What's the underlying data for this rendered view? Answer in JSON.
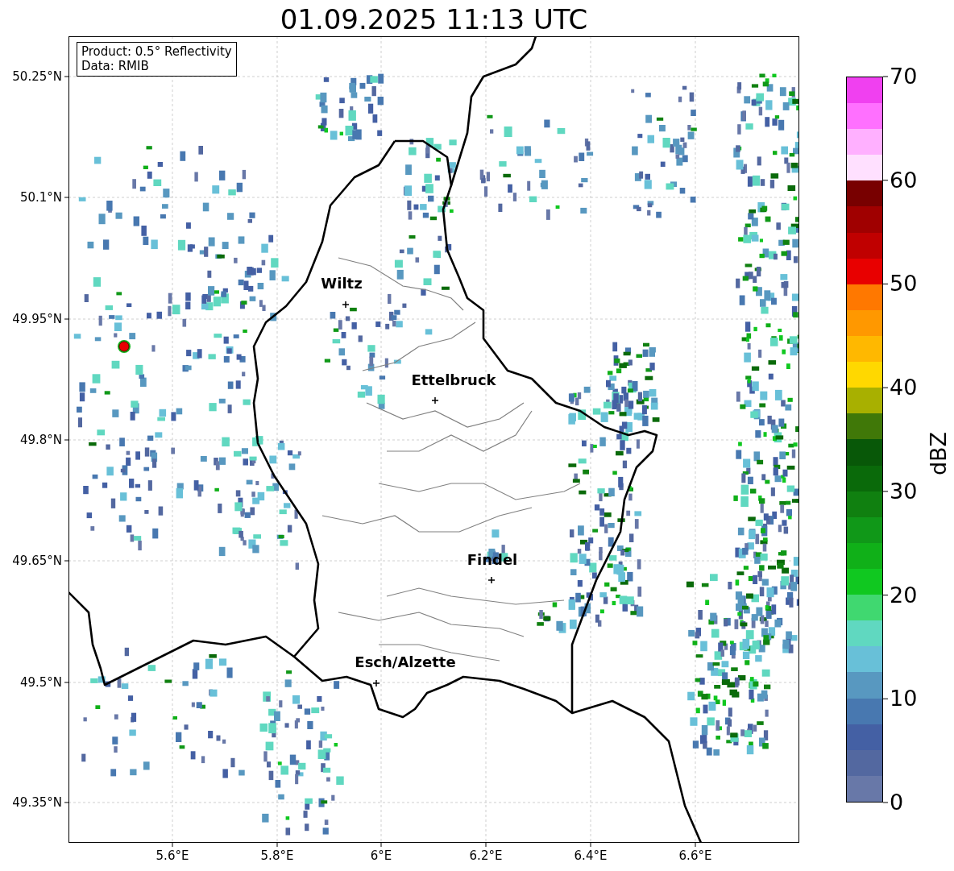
{
  "title": "01.09.2025 11:13 UTC",
  "info_box": {
    "lines": [
      "Product: 0.5° Reflectivity",
      "Data: RMIB"
    ]
  },
  "y_ticks": [
    "50.25°N",
    "50.1°N",
    "49.95°N",
    "49.8°N",
    "49.65°N",
    "49.5°N",
    "49.35°N"
  ],
  "x_ticks": [
    "5.6°E",
    "5.8°E",
    "6°E",
    "6.2°E",
    "6.4°E",
    "6.6°E"
  ],
  "places": [
    {
      "name": "Wiltz"
    },
    {
      "name": "Ettelbruck"
    },
    {
      "name": "Findel"
    },
    {
      "name": "Esch/Alzette"
    }
  ],
  "colorbar": {
    "label": "dBZ",
    "ticks": [
      "70",
      "60",
      "50",
      "40",
      "30",
      "20",
      "10",
      "0"
    ]
  }
}
